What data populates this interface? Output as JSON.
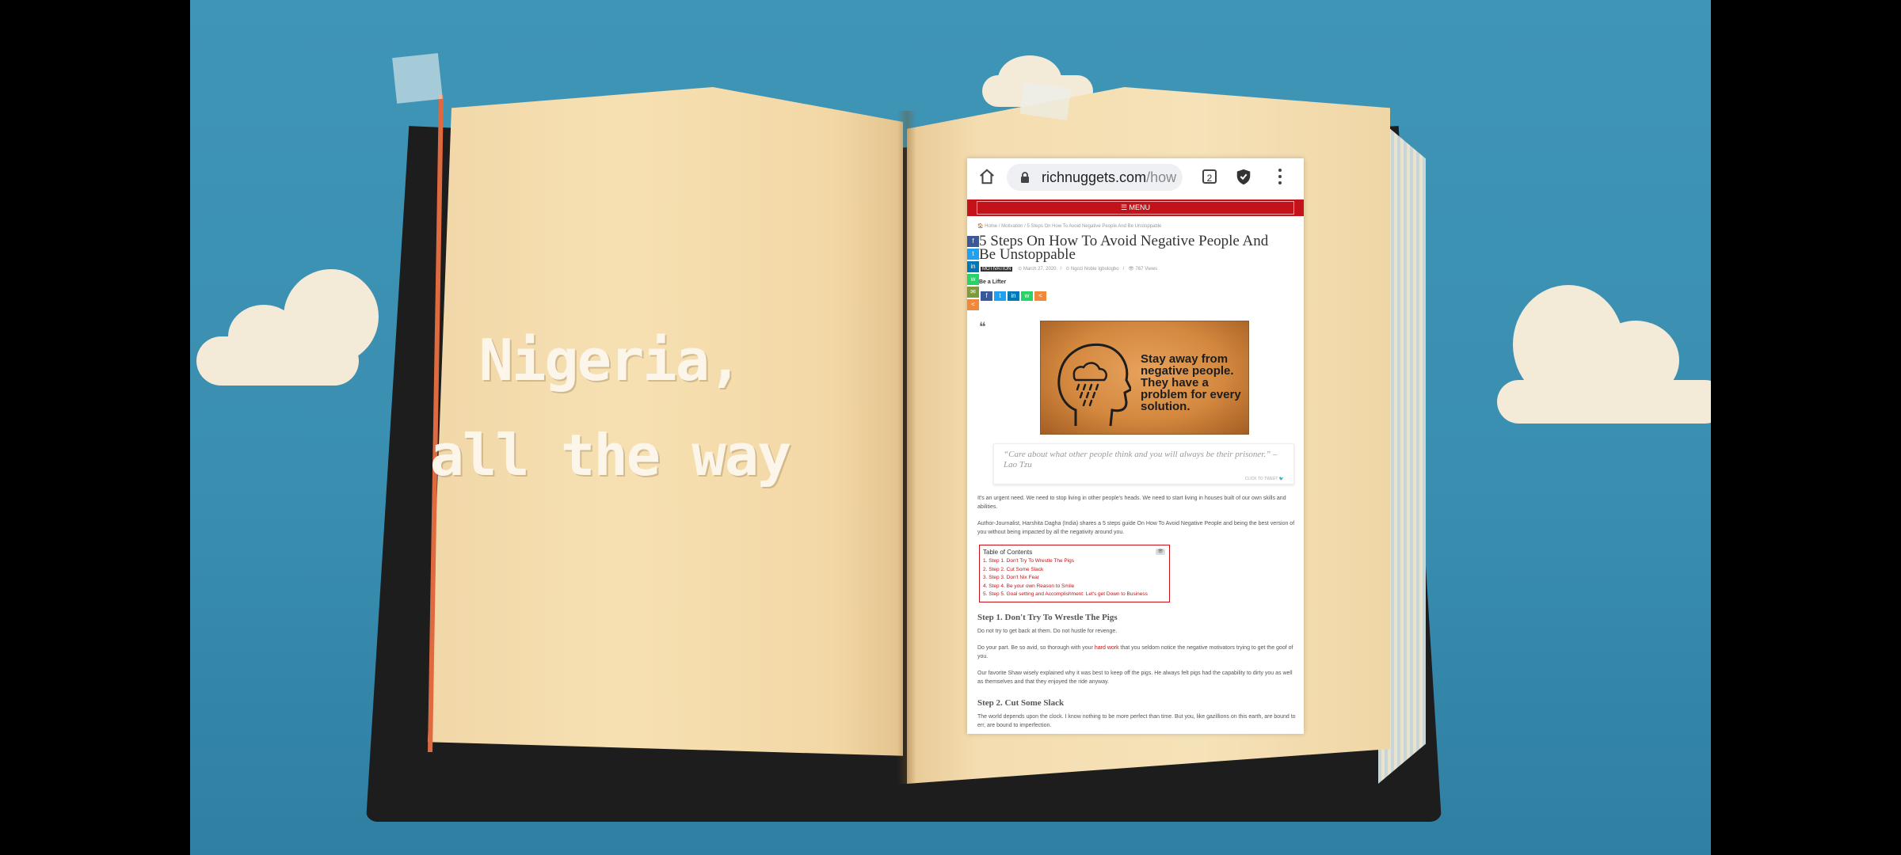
{
  "video": {
    "headline_line1": "Nigeria,",
    "headline_line2": "all the way"
  },
  "browser": {
    "url_host": "richnuggets.com",
    "url_path": "/how",
    "tab_count": "2",
    "icons": [
      "home-icon",
      "lock-icon",
      "tabs-icon",
      "shield-icon",
      "kebab-menu-icon"
    ]
  },
  "site": {
    "menu_label": "☰ MENU",
    "brand_color": "#c4121a",
    "breadcrumb": "🏠 Home  /  Motivation  /  5 Steps On How To Avoid Negative People And Be Unstoppable"
  },
  "article": {
    "title": "5 Steps On How To Avoid Negative People And Be Unstoppable",
    "badge": "MOTIVATION",
    "date": "⊙ March 27, 2020",
    "author": "⊙ Ngozi Noble Igbologbo",
    "views": "👁 767 Views",
    "lift_label": "Be a Lifter",
    "share_sidebar": [
      "f",
      "t",
      "in",
      "w",
      "✉",
      "<"
    ],
    "share_row": [
      "f",
      "t",
      "in",
      "w",
      "<"
    ],
    "hero_text": "Stay away from negative people. They have a problem for every solution.",
    "quote": "“Care about what other people think and you will always be their prisoner.” –Lao Tzu",
    "click_to_tweet": "CLICK TO TWEET 🐦",
    "intro_p1": "It's an urgent need. We need to stop living in other people's heads. We need to start living in houses built of our own skills and abilities.",
    "intro_p2": "Author-Journalist, Harshita Dagha (India) shares a 5 steps guide On How To Avoid Negative People and being the best version of you without being impacted by all the negativity around you.",
    "toc_title": "Table of Contents",
    "toc_items": [
      "1. Step 1. Don't Try To Wrestle The Pigs",
      "2. Step 2. Cut Some Slack",
      "3. Step 3. Don't Nix Fear",
      "4. Step 4. Be your own Reason to Smile",
      "5. Step 5. Goal setting and Accomplishment: Let's get Down to Business"
    ],
    "step1_heading": "Step 1. Don't Try To Wrestle The Pigs",
    "step1_p1": "Do not try to get back at them. Do not hustle for revenge.",
    "step1_p2_before": "Do your part. Be so avid, so thorough with your ",
    "step1_p2_link": "hard work",
    "step1_p2_after": " that you seldom notice the negative motivators trying to get the goof of you.",
    "step1_p3": "Our favorite Shaw wisely explained why it was best to keep off the pigs. He always felt pigs had the capability to dirty you as well as themselves and that they enjoyed the ride anyway.",
    "step2_heading": "Step 2. Cut Some Slack",
    "step2_p1": "The world depends upon the clock. I know nothing to be more perfect than time. But you, like gazillions on this earth, are bound to err, are bound to imperfection."
  }
}
